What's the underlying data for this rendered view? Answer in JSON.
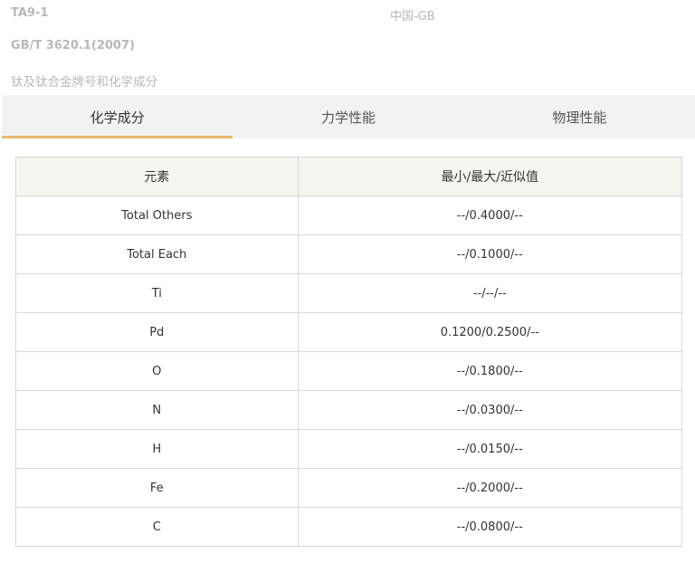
{
  "material": {
    "grade": "TA9-1",
    "country_standard": "中国-GB",
    "standard_no": "GB/T 3620.1(2007)",
    "standard_title": "钛及钛合金牌号和化学成分"
  },
  "tabs": [
    {
      "label": "化学成分",
      "active": true
    },
    {
      "label": "力学性能",
      "active": false
    },
    {
      "label": "物理性能",
      "active": false
    }
  ],
  "colors": {
    "accent": "#e9b96f",
    "tab_bg": "#f2f2f2",
    "header_bg": "#f5f5f0"
  },
  "table": {
    "headers": [
      "元素",
      "最小/最大/近似值"
    ],
    "rows": [
      {
        "element": "Total Others",
        "value": "--/0.4000/--"
      },
      {
        "element": "Total Each",
        "value": "--/0.1000/--"
      },
      {
        "element": "Ti",
        "value": "--/--/--"
      },
      {
        "element": "Pd",
        "value": "0.1200/0.2500/--"
      },
      {
        "element": "O",
        "value": "--/0.1800/--"
      },
      {
        "element": "N",
        "value": "--/0.0300/--"
      },
      {
        "element": "H",
        "value": "--/0.0150/--"
      },
      {
        "element": "Fe",
        "value": "--/0.2000/--"
      },
      {
        "element": "C",
        "value": "--/0.0800/--"
      }
    ]
  }
}
